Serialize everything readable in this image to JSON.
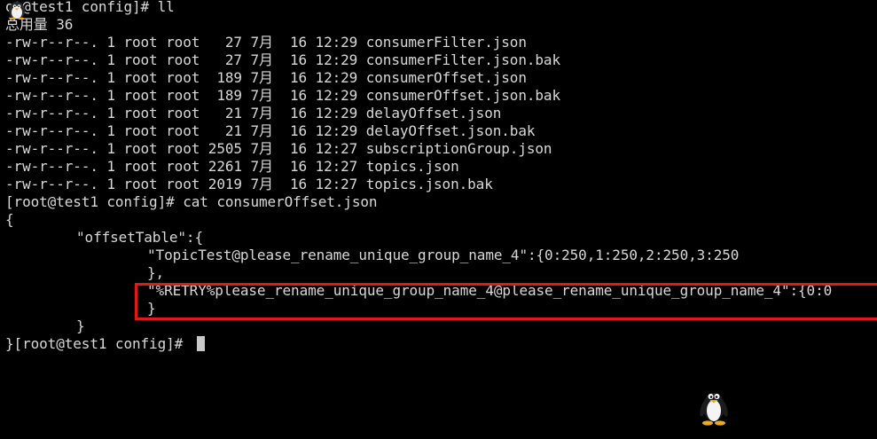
{
  "terminal": {
    "cursor_visible": true,
    "lines": [
      {
        "text": "ot@test1 config]# ll",
        "indent": 0
      },
      {
        "text": "总用量 36",
        "indent": 0
      },
      {
        "text": "-rw-r--r--. 1 root root   27 7月  16 12:29 consumerFilter.json",
        "indent": 0
      },
      {
        "text": "-rw-r--r--. 1 root root   27 7月  16 12:29 consumerFilter.json.bak",
        "indent": 0
      },
      {
        "text": "-rw-r--r--. 1 root root  189 7月  16 12:29 consumerOffset.json",
        "indent": 0
      },
      {
        "text": "-rw-r--r--. 1 root root  189 7月  16 12:29 consumerOffset.json.bak",
        "indent": 0
      },
      {
        "text": "-rw-r--r--. 1 root root   21 7月  16 12:29 delayOffset.json",
        "indent": 0
      },
      {
        "text": "-rw-r--r--. 1 root root   21 7月  16 12:29 delayOffset.json.bak",
        "indent": 0
      },
      {
        "text": "-rw-r--r--. 1 root root 2505 7月  16 12:27 subscriptionGroup.json",
        "indent": 0
      },
      {
        "text": "-rw-r--r--. 1 root root 2261 7月  16 12:27 topics.json",
        "indent": 0
      },
      {
        "text": "-rw-r--r--. 1 root root 2019 7月  16 12:27 topics.json.bak",
        "indent": 0
      },
      {
        "text": "[root@test1 config]# cat consumerOffset.json",
        "indent": 0
      },
      {
        "text": "{",
        "indent": 0
      },
      {
        "text": "\"offsetTable\":{",
        "indent": 1
      },
      {
        "text": "\"TopicTest@please_rename_unique_group_name_4\":{0:250,1:250,2:250,3:250",
        "indent": 2
      },
      {
        "text": "},",
        "indent": 2
      },
      {
        "text": "\"%RETRY%please_rename_unique_group_name_4@please_rename_unique_group_name_4\":{0:0",
        "indent": 2
      },
      {
        "text": "}",
        "indent": 2
      },
      {
        "text": "}",
        "indent": 1
      },
      {
        "text": "}[root@test1 config]# ",
        "indent": 0
      }
    ]
  },
  "annotation": {
    "color": "#e01919"
  },
  "colors": {
    "background": "#000000",
    "foreground": "#d8d8d8"
  },
  "icons": {
    "top_left": "tux-penguin-icon",
    "mascot": "tux-penguin-icon"
  }
}
